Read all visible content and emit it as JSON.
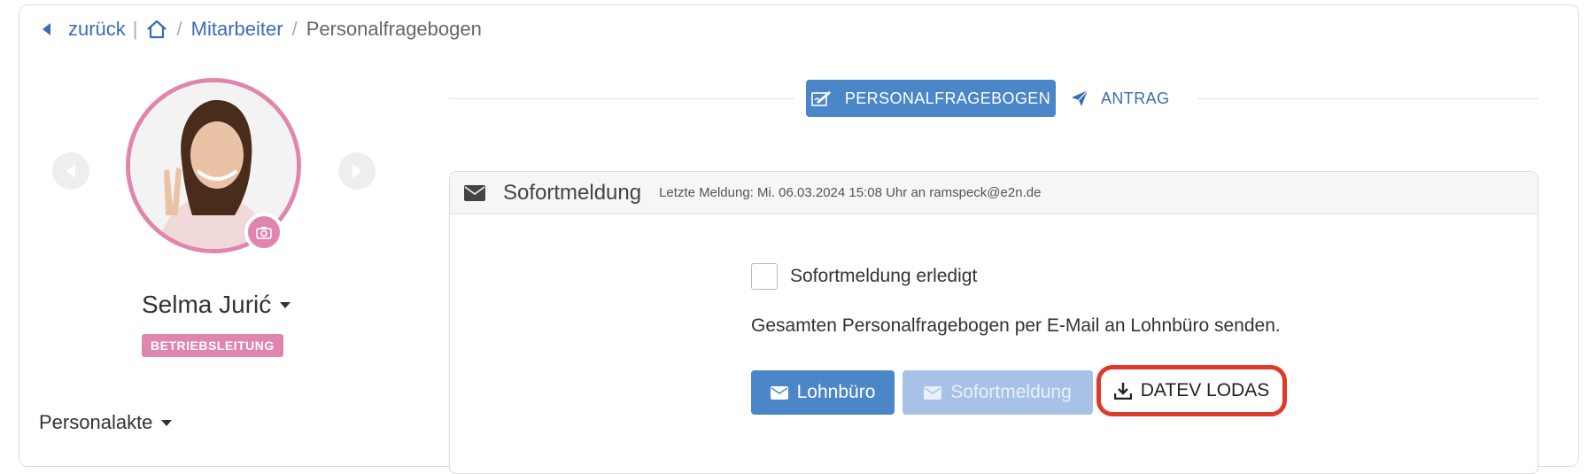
{
  "breadcrumb": {
    "back_label": "zurück",
    "separator_bar": "|",
    "separator_slash": "/",
    "items": [
      "Mitarbeiter",
      "Personalfragebogen"
    ]
  },
  "profile": {
    "name": "Selma Jurić",
    "role": "BETRIEBSLEITUNG",
    "personalakte_label": "Personalakte"
  },
  "tabs": {
    "active_label": "PERSONALFRAGEBOGEN",
    "secondary_label": "ANTRAG"
  },
  "card": {
    "title": "Sofortmeldung",
    "subtitle": "Letzte Meldung: Mi. 06.03.2024 15:08 Uhr an ramspeck@e2n.de",
    "checkbox_label": "Sofortmeldung erledigt",
    "info_text": "Gesamten Personalfragebogen per E-Mail an Lohnbüro senden."
  },
  "buttons": {
    "lohnbuero": "Lohnbüro",
    "sofortmeldung": "Sofortmeldung",
    "datev": "DATEV LODAS"
  },
  "colors": {
    "primary": "#4a86c8",
    "primary_disabled": "#a7c2e6",
    "accent_pink": "#e086ae",
    "highlight_red": "#e0392b",
    "link": "#3a6db5"
  },
  "icons": {
    "breadcrumb": [
      "caret-left-icon",
      "home-icon"
    ],
    "tabs": [
      "signature-icon",
      "paper-plane-icon"
    ],
    "card": [
      "envelope-icon",
      "download-icon",
      "camera-icon"
    ]
  }
}
